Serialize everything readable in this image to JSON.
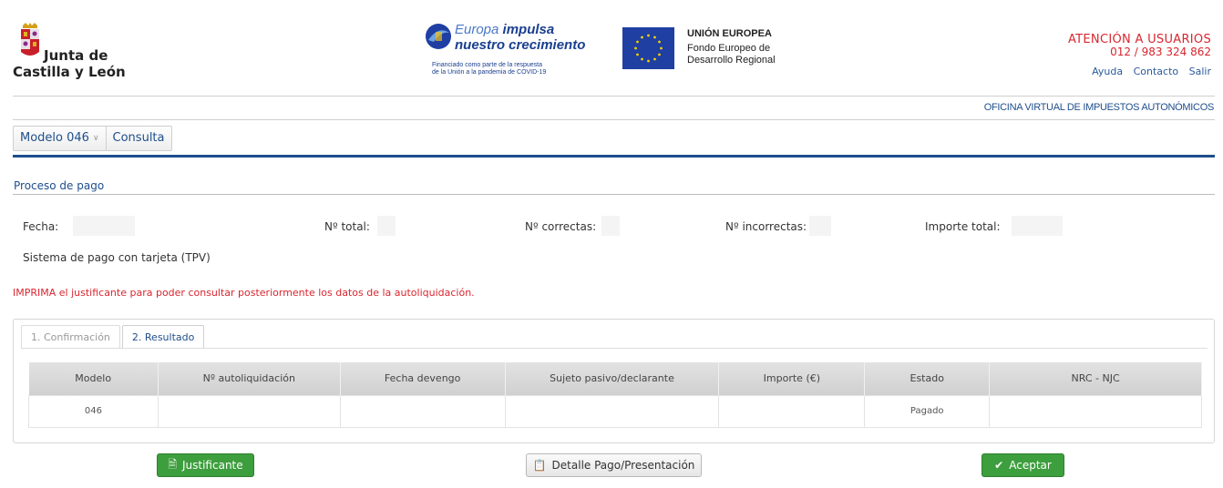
{
  "header": {
    "org_line1": "Junta de",
    "org_line2": "Castilla y León",
    "europa_light": "Europa",
    "europa_bold": " impulsa",
    "europa_line2": "nuestro crecimiento",
    "europa_small1": "Financiado como parte de la respuesta",
    "europa_small2": "de la Unión a la pandemia de COVID-19",
    "eu_title": "UNIÓN EUROPEA",
    "eu_line2": "Fondo Europeo de",
    "eu_line3": "Desarrollo Regional",
    "attention_title": "ATENCIÓN A USUARIOS",
    "attention_phone": "012 / 983 324 862",
    "links": [
      "Ayuda",
      "Contacto",
      "Salir"
    ]
  },
  "office_title": "OFICINA VIRTUAL DE IMPUESTOS AUTONÓMICOS",
  "menu": {
    "model_label": "Modelo 046",
    "consulta_label": "Consulta"
  },
  "section_title": "Proceso de pago",
  "summary": {
    "fecha_label": "Fecha:",
    "total_label": "Nº total:",
    "correctas_label": "Nº correctas:",
    "incorrectas_label": "Nº incorrectas:",
    "importe_label": "Importe total:"
  },
  "payment_system": "Sistema de pago con tarjeta (TPV)",
  "warning": "IMPRIMA el justificante para poder consultar posteriormente los datos de la autoliquidación.",
  "tabs": [
    {
      "label": "1. Confirmación",
      "active": false
    },
    {
      "label": "2. Resultado",
      "active": true
    }
  ],
  "table": {
    "headers": [
      "Modelo",
      "Nº autoliquidación",
      "Fecha devengo",
      "Sujeto pasivo/declarante",
      "Importe (€)",
      "Estado",
      "NRC - NJC"
    ],
    "rows": [
      [
        "046",
        "",
        "",
        "",
        "",
        "Pagado",
        ""
      ]
    ]
  },
  "buttons": {
    "justificante": "Justificante",
    "detalle": "Detalle Pago/Presentación",
    "aceptar": "Aceptar"
  },
  "colors": {
    "brand_blue": "#1e4e8c",
    "alert_red": "#d8262f",
    "success_green": "#3d9e3d"
  }
}
